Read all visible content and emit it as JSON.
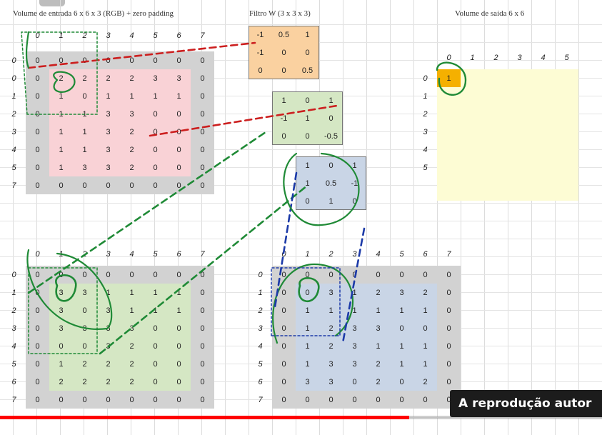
{
  "titles": {
    "input": "Volume de entrada 6 x 6 x 3 (RGB) + zero padding",
    "filter": "Filtro W (3 x 3 x 3)",
    "output": "Volume de saída 6 x 6"
  },
  "input_top": {
    "col_headers": [
      "0",
      "1",
      "2",
      "3",
      "4",
      "5",
      "6",
      "7"
    ],
    "row_headers": [
      "0",
      "0",
      "1",
      "2",
      "3",
      "4",
      "5",
      "7"
    ],
    "rows": [
      [
        "0",
        "0",
        "0",
        "0",
        "0",
        "0",
        "0",
        "0"
      ],
      [
        "0",
        "2",
        "2",
        "2",
        "2",
        "3",
        "3",
        "0"
      ],
      [
        "0",
        "1",
        "0",
        "1",
        "1",
        "1",
        "1",
        "0"
      ],
      [
        "0",
        "1",
        "1",
        "3",
        "3",
        "0",
        "0",
        "0"
      ],
      [
        "0",
        "1",
        "1",
        "3",
        "2",
        "0",
        "0",
        "0"
      ],
      [
        "0",
        "1",
        "1",
        "3",
        "2",
        "0",
        "0",
        "0"
      ],
      [
        "0",
        "1",
        "3",
        "3",
        "2",
        "0",
        "0",
        "0"
      ],
      [
        "0",
        "0",
        "0",
        "0",
        "0",
        "0",
        "0",
        "0"
      ]
    ]
  },
  "filter": {
    "k1": [
      [
        "-1",
        "0.5",
        "1"
      ],
      [
        "-1",
        "0",
        "0"
      ],
      [
        "0",
        "0",
        "0.5"
      ]
    ],
    "k2": [
      [
        "1",
        "0",
        "1"
      ],
      [
        "-1",
        "1",
        "0"
      ],
      [
        "0",
        "0",
        "-0.5"
      ]
    ],
    "k3": [
      [
        "1",
        "0",
        "1"
      ],
      [
        "1",
        "0.5",
        "-1"
      ],
      [
        "0",
        "1",
        "0"
      ]
    ]
  },
  "output": {
    "col_headers": [
      "0",
      "1",
      "2",
      "3",
      "4",
      "5"
    ],
    "row_headers": [
      "0",
      "1",
      "2",
      "3",
      "4",
      "5"
    ],
    "first_value": "1"
  },
  "input_green": {
    "col_headers": [
      "0",
      "1",
      "2",
      "3",
      "4",
      "5",
      "6",
      "7"
    ],
    "row_headers": [
      "0",
      "1",
      "2",
      "3",
      "4",
      "5",
      "6",
      "7"
    ],
    "rows": [
      [
        "0",
        "0",
        "0",
        "0",
        "0",
        "0",
        "0",
        "0"
      ],
      [
        "0",
        "3",
        "3",
        "1",
        "1",
        "1",
        "1",
        "0"
      ],
      [
        "0",
        "3",
        "0",
        "3",
        "1",
        "1",
        "1",
        "0"
      ],
      [
        "0",
        "3",
        "3",
        "3",
        "3",
        "0",
        "0",
        "0"
      ],
      [
        "0",
        "0",
        "0",
        "3",
        "2",
        "0",
        "0",
        "0"
      ],
      [
        "0",
        "1",
        "2",
        "2",
        "2",
        "0",
        "0",
        "0"
      ],
      [
        "0",
        "2",
        "2",
        "2",
        "2",
        "0",
        "0",
        "0"
      ],
      [
        "0",
        "0",
        "0",
        "0",
        "0",
        "0",
        "0",
        "0"
      ]
    ]
  },
  "input_blue": {
    "col_headers": [
      "0",
      "1",
      "2",
      "3",
      "4",
      "5",
      "6",
      "7"
    ],
    "row_headers": [
      "0",
      "1",
      "2",
      "3",
      "4",
      "5",
      "6",
      "7"
    ],
    "rows": [
      [
        "0",
        "0",
        "0",
        "0",
        "0",
        "0",
        "0",
        "0"
      ],
      [
        "0",
        "0",
        "3",
        "1",
        "2",
        "3",
        "2",
        "0"
      ],
      [
        "0",
        "1",
        "1",
        "1",
        "1",
        "1",
        "1",
        "0"
      ],
      [
        "0",
        "1",
        "2",
        "3",
        "3",
        "0",
        "0",
        "0"
      ],
      [
        "0",
        "1",
        "2",
        "3",
        "1",
        "1",
        "1",
        "0"
      ],
      [
        "0",
        "1",
        "3",
        "3",
        "2",
        "1",
        "1",
        "0"
      ],
      [
        "0",
        "3",
        "3",
        "0",
        "2",
        "0",
        "2",
        "0"
      ],
      [
        "0",
        "0",
        "0",
        "0",
        "0",
        "0",
        "0",
        "0"
      ]
    ]
  },
  "overlay": {
    "badge_text": "A reprodução autor",
    "progress": 0.68
  },
  "colors": {
    "pink": "#f9d2d6",
    "green": "#d5e7c4",
    "blue": "#c9d5e6",
    "gray": "#d2d2d2",
    "orange": "#fad1a0",
    "yellow": "#fdfcd4",
    "highlight": "#f5b000",
    "ink_red": "#cc1f1f",
    "ink_green": "#1f8a36",
    "ink_blue": "#1c3aa8"
  }
}
